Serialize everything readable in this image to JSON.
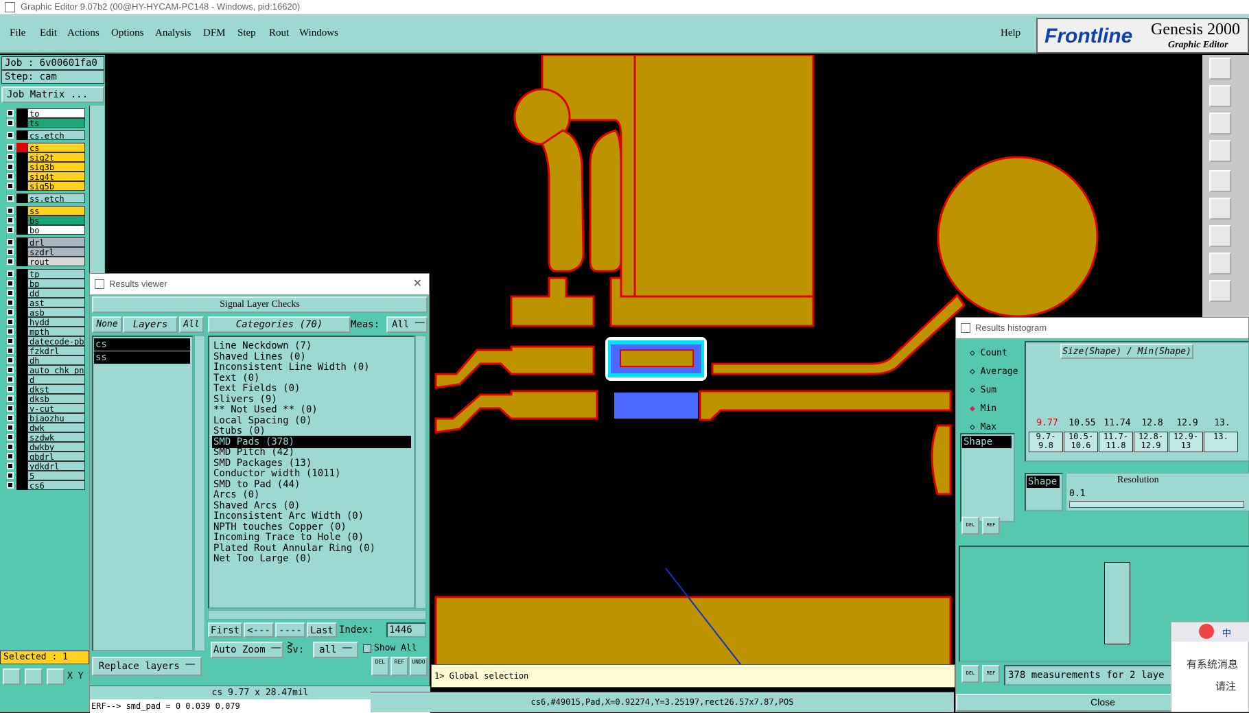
{
  "window": {
    "title": "Graphic Editor 9.07b2 (00@HY-HYCAM-PC148 - Windows, pid:16620)"
  },
  "menu": {
    "items": [
      "File",
      "Edit",
      "Actions",
      "Options",
      "Analysis",
      "DFM",
      "Step",
      "Rout",
      "Windows"
    ],
    "help": "Help"
  },
  "logo": {
    "brand": "Frontline",
    "product": "Genesis 2000",
    "subtitle": "Graphic Editor"
  },
  "job": {
    "job": "Job :  6v00601fa0",
    "step": "Step:  cam",
    "matrix_button": "Job Matrix ..."
  },
  "layers": [
    "to",
    "ts",
    "cs.etch",
    "cs",
    "sig2t",
    "sig3b",
    "sig4t",
    "sig5b",
    "ss.etch",
    "ss",
    "bs",
    "bo",
    "drl",
    "szdrl",
    "rout",
    "tp",
    "bp",
    "dd",
    "ast",
    "asb",
    "hydd",
    "mpth",
    "datecode-pb",
    "fzkdrl",
    "dh",
    "auto_chk_pn",
    "d",
    "dkst",
    "dksb",
    "v-cut",
    "biaozhu",
    "dwk",
    "szdwk",
    "dwkby",
    "gbdrl",
    "ydkdrl",
    "5",
    "cs6"
  ],
  "selected": "Selected : 1",
  "results_viewer": {
    "title": "Results viewer",
    "header": "Signal Layer Checks",
    "none_btn": "None",
    "layers_btn": "Layers",
    "all_btn": "All",
    "layers_list": [
      "cs",
      "ss"
    ],
    "categories_label": "Categories (70)",
    "meas_label": "Meas:",
    "meas_value": "All",
    "categories": [
      "Line Neckdown (7)",
      "Shaved Lines (0)",
      "Inconsistent Line Width (0)",
      "Text (0)",
      "Text Fields (0)",
      "Slivers (9)",
      "** Not Used ** (0)",
      "Local Spacing (0)",
      "Stubs (0)",
      "SMD Pads (378)",
      "SMD Pitch (42)",
      "SMD Packages (13)",
      "Conductor width (1011)",
      "SMD to Pad (44)",
      "Arcs (0)",
      "Shaved Arcs (0)",
      "Inconsistent Arc Width (0)",
      "NPTH touches Copper (0)",
      "Incoming Trace to Hole (0)",
      "Plated Rout Annular Ring (0)",
      "Net Too Large (0)"
    ],
    "selected_category": "SMD Pads (378)",
    "nav": {
      "first": "First",
      "prev": "<----",
      "next": "---->",
      "last": "Last",
      "index_label": "Index:",
      "index_value": "1446"
    },
    "auto_zoom": "Auto Zoom",
    "sv_label": "Sv:",
    "sv_value": "all",
    "show_all": "Show All",
    "replace_layers": "Replace layers",
    "del": "DEL",
    "ref": "REF",
    "undo": "UNDO",
    "info": "cs 9.77 x 28.47mil",
    "erf": "ERF--> smd_pad = 0 0.039 0.079"
  },
  "histogram": {
    "title": "Results histogram",
    "modes": [
      "Count",
      "Average",
      "Sum",
      "Min",
      "Max"
    ],
    "selected_mode": "Min",
    "size_label": "Size(Shape) / Min(Shape)",
    "shape_label": "Shape",
    "bins_top": [
      "9.77",
      "10.55",
      "11.74",
      "12.8",
      "12.9",
      "13."
    ],
    "bins_range": [
      [
        "9.7-",
        "9.8"
      ],
      [
        "10.5-",
        "10.6"
      ],
      [
        "11.7-",
        "11.8"
      ],
      [
        "12.8-",
        "12.9"
      ],
      [
        "12.9-",
        "13"
      ],
      [
        "13.",
        ""
      ]
    ],
    "resolution_label": "Resolution",
    "resolution_value": "0.1",
    "measurements": "378 measurements for 2 laye",
    "close": "Close"
  },
  "command_line": "1> Global selection",
  "coords": "X Y",
  "status_feature": "cs6,#49015,Pad,X=0.92274,Y=3.25197,rect26.57x7.87,POS",
  "ime": {
    "line1": "有系统消息",
    "line2": "请注",
    "tab": "中"
  },
  "colors": {
    "copper": "#bd9400",
    "outline": "#e00000",
    "panel": "#56c8b0",
    "cyan": "#9ed8d2",
    "highlight": "#4a6aff"
  }
}
